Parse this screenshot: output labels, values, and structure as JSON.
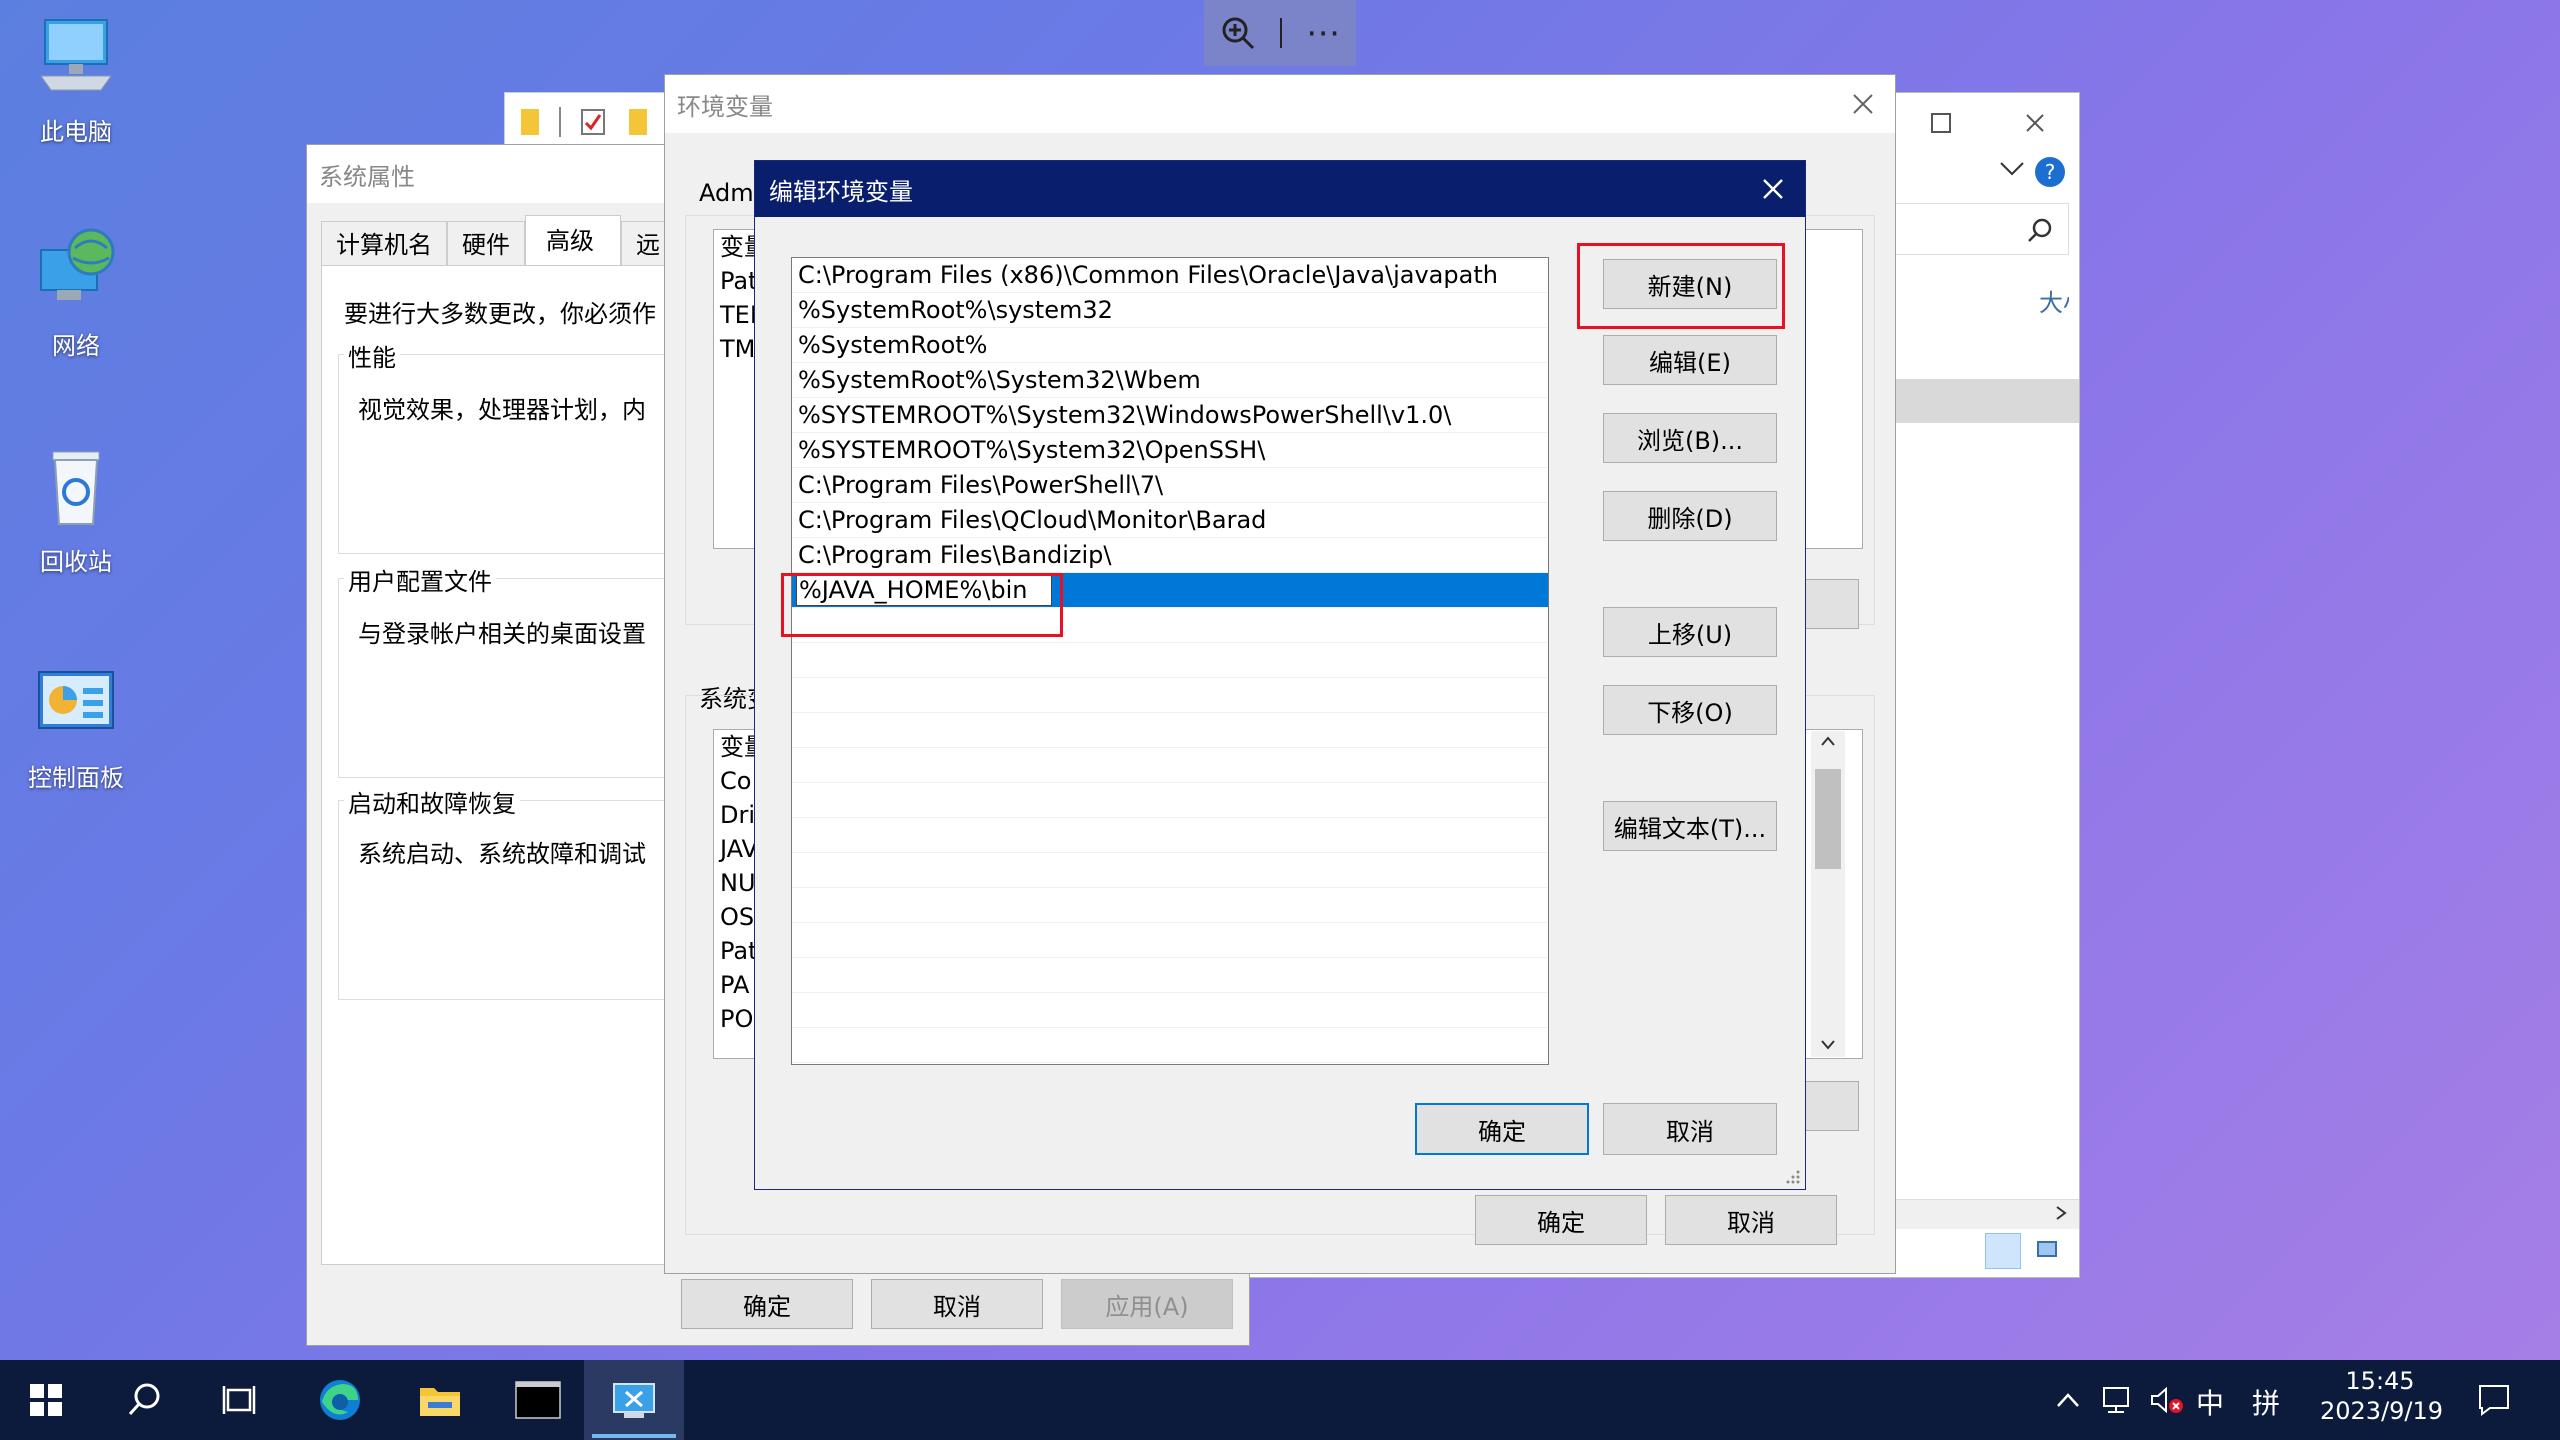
{
  "desktop": {
    "icons": [
      {
        "label": "此电脑",
        "icon": "computer-icon"
      },
      {
        "label": "网络",
        "icon": "network-icon"
      },
      {
        "label": "回收站",
        "icon": "recycle-bin-icon"
      },
      {
        "label": "控制面板",
        "icon": "control-panel-icon"
      }
    ]
  },
  "zoombar": {
    "more": "⋯"
  },
  "sysprops": {
    "title": "系统属性",
    "tabs": [
      "计算机名",
      "硬件",
      "高级",
      "远"
    ],
    "active_tab": "高级",
    "intro": "要进行大多数更改，你必须作",
    "perf_title": "性能",
    "perf_desc": "视觉效果，处理器计划，内",
    "profile_title": "用户配置文件",
    "profile_desc": "与登录帐户相关的桌面设置",
    "startup_title": "启动和故障恢复",
    "startup_desc": "系统启动、系统故障和调试",
    "ok": "确定",
    "cancel": "取消",
    "apply": "应用(A)"
  },
  "envvars": {
    "title": "环境变量",
    "user_label": "Adm",
    "user_rows": [
      "变量",
      "Pat",
      "TEI",
      "TM"
    ],
    "sys_label": "系统变",
    "sys_rows": [
      "变量",
      "Co",
      "Dri",
      "JAV",
      "NU",
      "OS",
      "Pat",
      "PA",
      "PO"
    ],
    "ok": "确定",
    "cancel": "取消"
  },
  "explorer": {
    "col_header": "大小"
  },
  "edit_dialog": {
    "title": "编辑环境变量",
    "entries": [
      "C:\\Program Files (x86)\\Common Files\\Oracle\\Java\\javapath",
      "%SystemRoot%\\system32",
      "%SystemRoot%",
      "%SystemRoot%\\System32\\Wbem",
      "%SYSTEMROOT%\\System32\\WindowsPowerShell\\v1.0\\",
      "%SYSTEMROOT%\\System32\\OpenSSH\\",
      "C:\\Program Files\\PowerShell\\7\\",
      "C:\\Program Files\\QCloud\\Monitor\\Barad",
      "C:\\Program Files\\Bandizip\\"
    ],
    "editing_value": "%JAVA_HOME%\\bin",
    "buttons": {
      "new": "新建(N)",
      "edit": "编辑(E)",
      "browse": "浏览(B)...",
      "delete": "删除(D)",
      "up": "上移(U)",
      "down": "下移(O)",
      "edit_text": "编辑文本(T)..."
    },
    "ok": "确定",
    "cancel": "取消"
  },
  "taskbar": {
    "time": "15:45",
    "date": "2023/9/19",
    "ime_lang": "中",
    "ime_mode": "拼"
  }
}
